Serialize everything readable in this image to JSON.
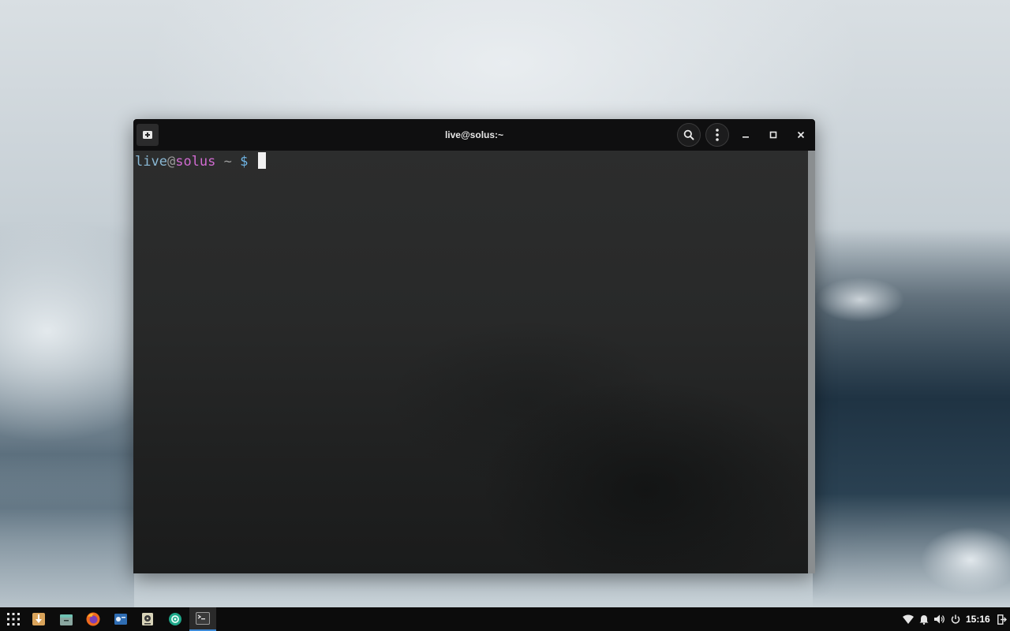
{
  "window": {
    "title": "live@solus:~",
    "prompt": {
      "user": "live",
      "at": "@",
      "host": "solus",
      "path": " ~ ",
      "symbol": "$ "
    }
  },
  "titlebar_icons": [
    "new-tab-icon",
    "search-icon",
    "menu-kebab-icon",
    "minimize-icon",
    "maximize-icon",
    "close-icon"
  ],
  "taskbar": {
    "apps": [
      {
        "name": "app-grid-icon"
      },
      {
        "name": "software-center-icon"
      },
      {
        "name": "files-icon"
      },
      {
        "name": "firefox-icon"
      },
      {
        "name": "disk-icon"
      },
      {
        "name": "audio-player-icon"
      },
      {
        "name": "settings-icon"
      },
      {
        "name": "terminal-icon",
        "active": true
      }
    ],
    "tray": [
      "network-icon",
      "notification-bell-icon",
      "volume-icon",
      "power-icon"
    ],
    "clock": "15:16",
    "end_icon": "logout-icon"
  },
  "colors": {
    "user": "#8ab8d4",
    "host": "#d06bd0",
    "dollar": "#6fb5e6",
    "active_task_accent": "#3c8ad8"
  }
}
